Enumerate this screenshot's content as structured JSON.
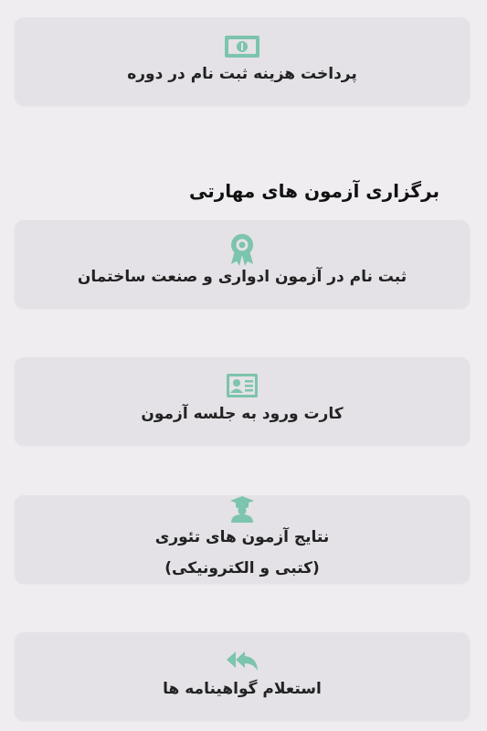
{
  "accent_color": "#7cc4ad",
  "cards": [
    {
      "label": "پرداخت هزینه ثبت نام در دوره",
      "icon": "money-bill-icon"
    },
    {
      "label": "ثبت نام در آزمون ادواری و صنعت ساختمان",
      "icon": "award-ribbon-icon"
    },
    {
      "label": "کارت ورود به جلسه آزمون",
      "icon": "id-card-icon"
    },
    {
      "label_line1": "نتایج آزمون های تئوری",
      "label_line2": "(کتبی و الکترونیکی)",
      "icon": "graduate-user-icon"
    },
    {
      "label": "استعلام گواهینامه ها",
      "icon": "reply-all-icon"
    }
  ],
  "section": {
    "title": "برگزاری آزمون های مهارتی"
  }
}
